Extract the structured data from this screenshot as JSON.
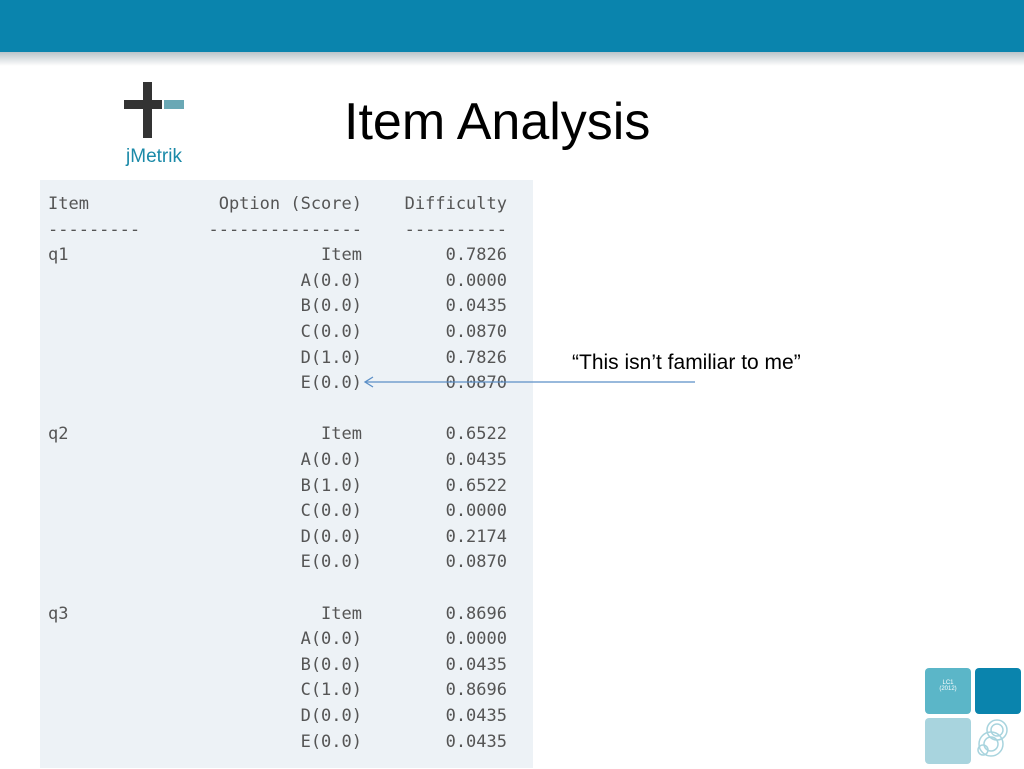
{
  "slide": {
    "title": "Item Analysis",
    "logo_text": "jMetrik",
    "callout": "“This isn’t familiar to me”",
    "badge_text": "LC1\n(2012)"
  },
  "colors": {
    "top_bar": "#0a84ad",
    "output_bg": "#edf2f6",
    "accent": "#1b8aa8"
  },
  "output": {
    "headers": [
      "Item",
      "Option (Score)",
      "Difficulty"
    ],
    "rules": [
      "---------",
      "---------------",
      "----------"
    ],
    "groups": [
      {
        "item": "q1",
        "rows": [
          {
            "option": "Item",
            "difficulty": "0.7826"
          },
          {
            "option": "A(0.0)",
            "difficulty": "0.0000"
          },
          {
            "option": "B(0.0)",
            "difficulty": "0.0435"
          },
          {
            "option": "C(0.0)",
            "difficulty": "0.0870"
          },
          {
            "option": "D(1.0)",
            "difficulty": "0.7826"
          },
          {
            "option": "E(0.0)",
            "difficulty": "0.0870"
          }
        ]
      },
      {
        "item": "q2",
        "rows": [
          {
            "option": "Item",
            "difficulty": "0.6522"
          },
          {
            "option": "A(0.0)",
            "difficulty": "0.0435"
          },
          {
            "option": "B(1.0)",
            "difficulty": "0.6522"
          },
          {
            "option": "C(0.0)",
            "difficulty": "0.0000"
          },
          {
            "option": "D(0.0)",
            "difficulty": "0.2174"
          },
          {
            "option": "E(0.0)",
            "difficulty": "0.0870"
          }
        ]
      },
      {
        "item": "q3",
        "rows": [
          {
            "option": "Item",
            "difficulty": "0.8696"
          },
          {
            "option": "A(0.0)",
            "difficulty": "0.0000"
          },
          {
            "option": "B(0.0)",
            "difficulty": "0.0435"
          },
          {
            "option": "C(1.0)",
            "difficulty": "0.8696"
          },
          {
            "option": "D(0.0)",
            "difficulty": "0.0435"
          },
          {
            "option": "E(0.0)",
            "difficulty": "0.0435"
          }
        ]
      }
    ]
  }
}
